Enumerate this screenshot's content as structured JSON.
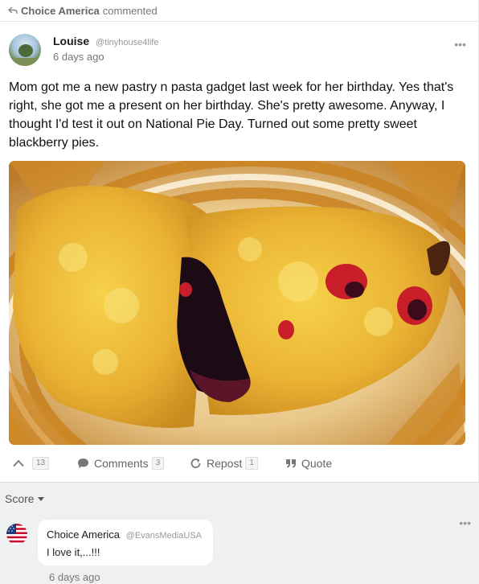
{
  "activity": {
    "actor": "Choice America",
    "verb": "commented",
    "icon": "repost-icon"
  },
  "post": {
    "author_name": "Louise",
    "author_handle": "@tinyhouse4life",
    "time": "6 days ago",
    "more": "•••",
    "text": "Mom got me a new pastry n pasta gadget last week for her birthday. Yes that's right, she got me a present on her birthday. She's pretty awesome. Anyway, I thought I'd test it out on National Pie Day. Turned out some pretty sweet blackberry pies.",
    "image_subject": "fried blackberry hand pies on a striped plate"
  },
  "actions": {
    "upvote": {
      "icon": "chevron-up-icon",
      "count": "13"
    },
    "comments": {
      "icon": "comment-bubble-icon",
      "label": "Comments",
      "count": "3"
    },
    "repost": {
      "icon": "repost-icon",
      "label": "Repost",
      "count": "1"
    },
    "quote": {
      "icon": "quote-icon",
      "label": "Quote"
    }
  },
  "comments_section": {
    "sort_label": "Score",
    "comments": [
      {
        "author_name": "Choice America",
        "author_handle": "@EvansMediaUSA",
        "text": "I love it,...!!!",
        "time": "6 days ago",
        "more": "•••",
        "avatar_icon": "us-flag-icon"
      }
    ]
  },
  "colors": {
    "accent_text": "#777777",
    "panel_bg": "#eff0f2",
    "count_bg": "#f4f4f4"
  }
}
